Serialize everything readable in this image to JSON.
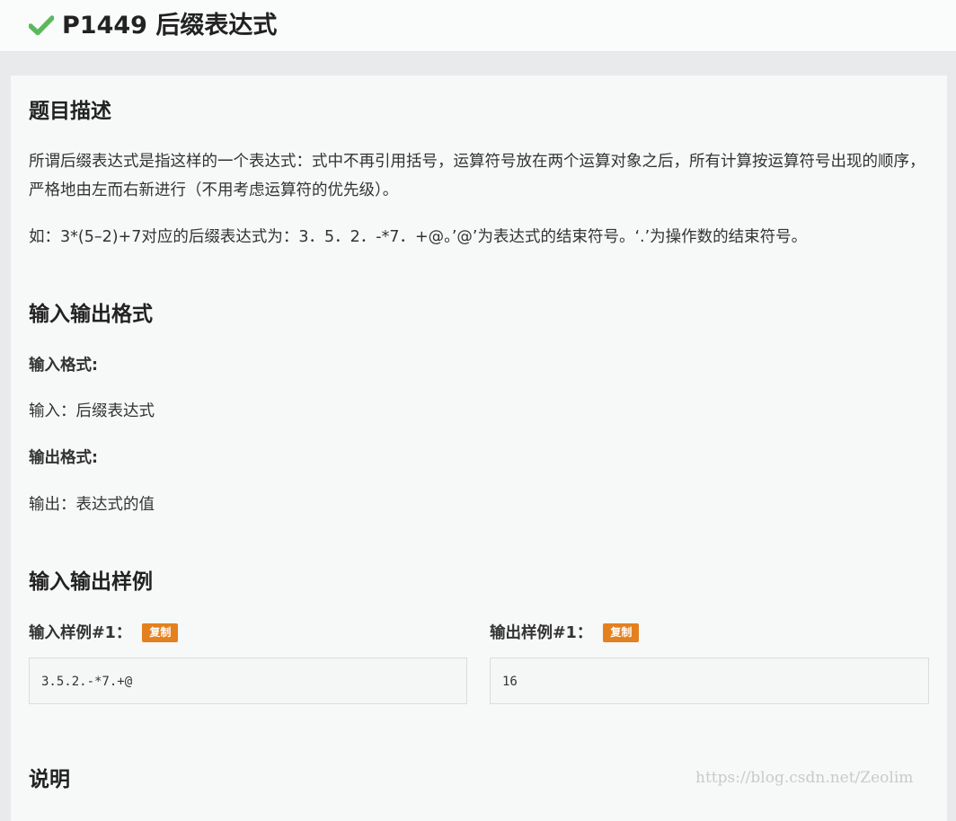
{
  "header": {
    "status_icon": "check-icon",
    "title": "P1449 后缀表达式",
    "accent_color": "#5cb85c"
  },
  "description": {
    "heading": "题目描述",
    "para1": "所谓后缀表达式是指这样的一个表达式：式中不再引用括号，运算符号放在两个运算对象之后，所有计算按运算符号出现的顺序，严格地由左而右新进行（不用考虑运算符的优先级）。",
    "para2": "如：3*(5–2)+7对应的后缀表达式为：3．5．2．-*7．+@。’@’为表达式的结束符号。‘.’为操作数的结束符号。"
  },
  "io_format": {
    "heading": "输入输出格式",
    "input_label": "输入格式:",
    "input_text": "输入：后缀表达式",
    "output_label": "输出格式:",
    "output_text": "输出：表达式的值"
  },
  "samples": {
    "heading": "输入输出样例",
    "input_label": "输入样例#1：",
    "output_label": "输出样例#1：",
    "copy_label": "复制",
    "copy_color": "#e5801e",
    "input_value": "3.5.2.-*7.+@",
    "output_value": "16"
  },
  "explanation": {
    "heading": "说明"
  },
  "watermark": "https://blog.csdn.net/Zeolim"
}
